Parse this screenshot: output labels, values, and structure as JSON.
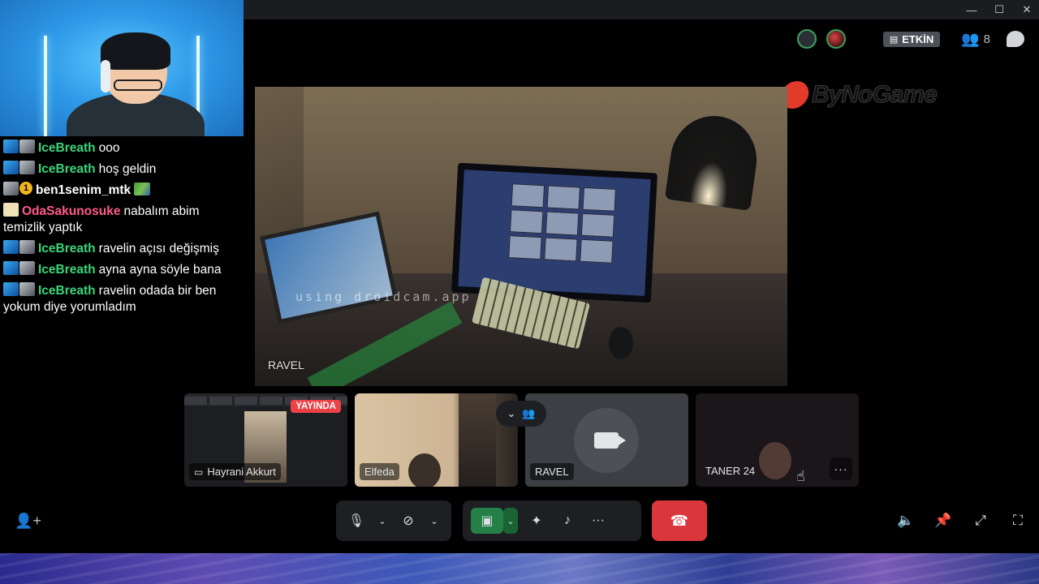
{
  "window": {
    "minimize": "—",
    "maximize": "☐",
    "close": "✕"
  },
  "chat": [
    {
      "user": "IceBreath",
      "color": "#3bd67b",
      "badges": [
        "blue",
        "grey"
      ],
      "text": "ooo"
    },
    {
      "user": "IceBreath",
      "color": "#3bd67b",
      "badges": [
        "blue",
        "grey"
      ],
      "text": "hoş geldin"
    },
    {
      "user": "ben1senim_mtk",
      "color": "#ffffff",
      "badges": [
        "grey",
        "yellow"
      ],
      "text": "",
      "emote": true
    },
    {
      "user": "OdaSakunosuke",
      "color": "#ff5a8a",
      "badges": [
        "cream"
      ],
      "text": "nabalım abim temizlik yaptık"
    },
    {
      "user": "IceBreath",
      "color": "#3bd67b",
      "badges": [
        "blue",
        "grey"
      ],
      "text": "ravelin açısı değişmiş"
    },
    {
      "user": "IceBreath",
      "color": "#3bd67b",
      "badges": [
        "blue",
        "grey"
      ],
      "text": "ayna ayna söyle bana"
    },
    {
      "user": "IceBreath",
      "color": "#3bd67b",
      "badges": [
        "blue",
        "grey"
      ],
      "text": "ravelin odada bir ben yokum diye yorumladım"
    }
  ],
  "status": {
    "event_label": "ETKİN",
    "participant_count": "8"
  },
  "logo": {
    "text": "ByNoGame"
  },
  "main_video": {
    "watermark": "using droidcam.app",
    "name": "RAVEL"
  },
  "thumbnails": [
    {
      "name": "Hayrani Akkurt",
      "live_label": "YAYINDA"
    },
    {
      "name": "Elfeda"
    },
    {
      "name": "RAVEL"
    },
    {
      "name": "TANER 24",
      "more": "···"
    }
  ],
  "colors": {
    "accent_green": "#248046",
    "hangup_red": "#da373c",
    "live_red": "#ed4245",
    "speaking_green": "#3ba55c"
  }
}
